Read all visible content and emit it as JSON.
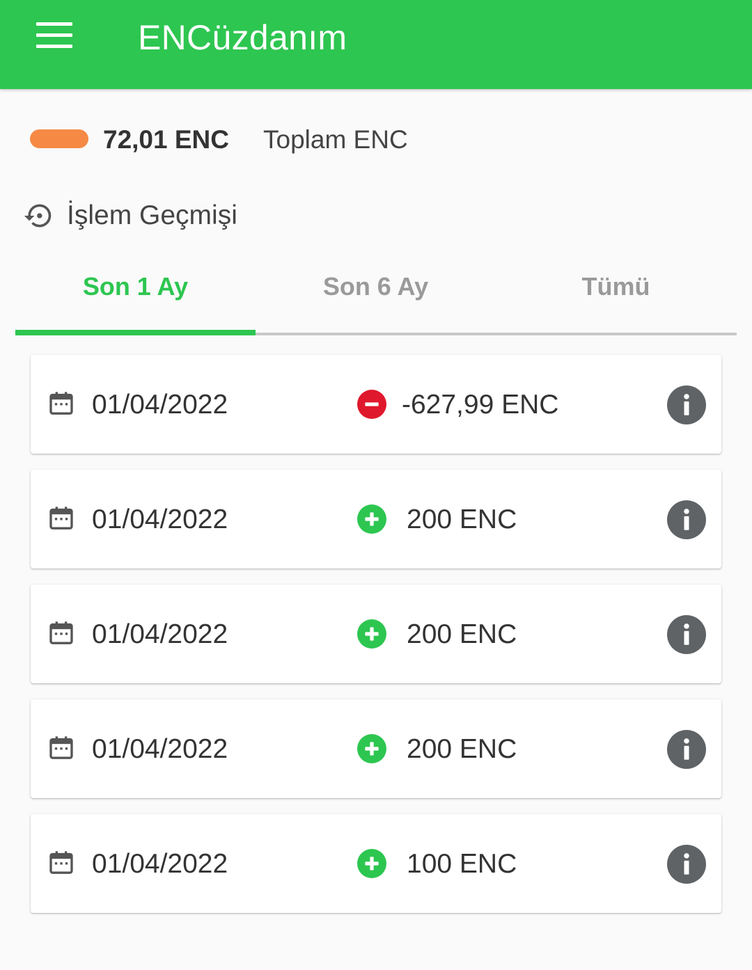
{
  "app_bar": {
    "title": "ENCüzdanım",
    "color": "#2dc650",
    "menu_icon": "hamburger-menu-icon"
  },
  "balance": {
    "amount": "72,01 ENC",
    "label": "Toplam ENC",
    "pill_color": "#f68a45"
  },
  "history": {
    "icon": "history-icon",
    "title": "İşlem Geçmişi"
  },
  "tabs": [
    {
      "label": "Son 1 Ay",
      "active": true
    },
    {
      "label": "Son 6 Ay",
      "active": false
    },
    {
      "label": "Tümü",
      "active": false
    }
  ],
  "transactions": [
    {
      "date": "01/04/2022",
      "type": "minus",
      "amount": "-627,99 ENC"
    },
    {
      "date": "01/04/2022",
      "type": "plus",
      "amount": "200 ENC"
    },
    {
      "date": "01/04/2022",
      "type": "plus",
      "amount": "200 ENC"
    },
    {
      "date": "01/04/2022",
      "type": "plus",
      "amount": "200 ENC"
    },
    {
      "date": "01/04/2022",
      "type": "plus",
      "amount": "100 ENC"
    }
  ],
  "icons": {
    "calendar": "calendar-icon",
    "plus": "plus-circle-icon",
    "minus": "minus-circle-icon",
    "info": "info-icon"
  },
  "colors": {
    "accent": "#2dc650",
    "negative": "#e0182d",
    "positive": "#2dc650",
    "info_bg": "#5f6366"
  }
}
